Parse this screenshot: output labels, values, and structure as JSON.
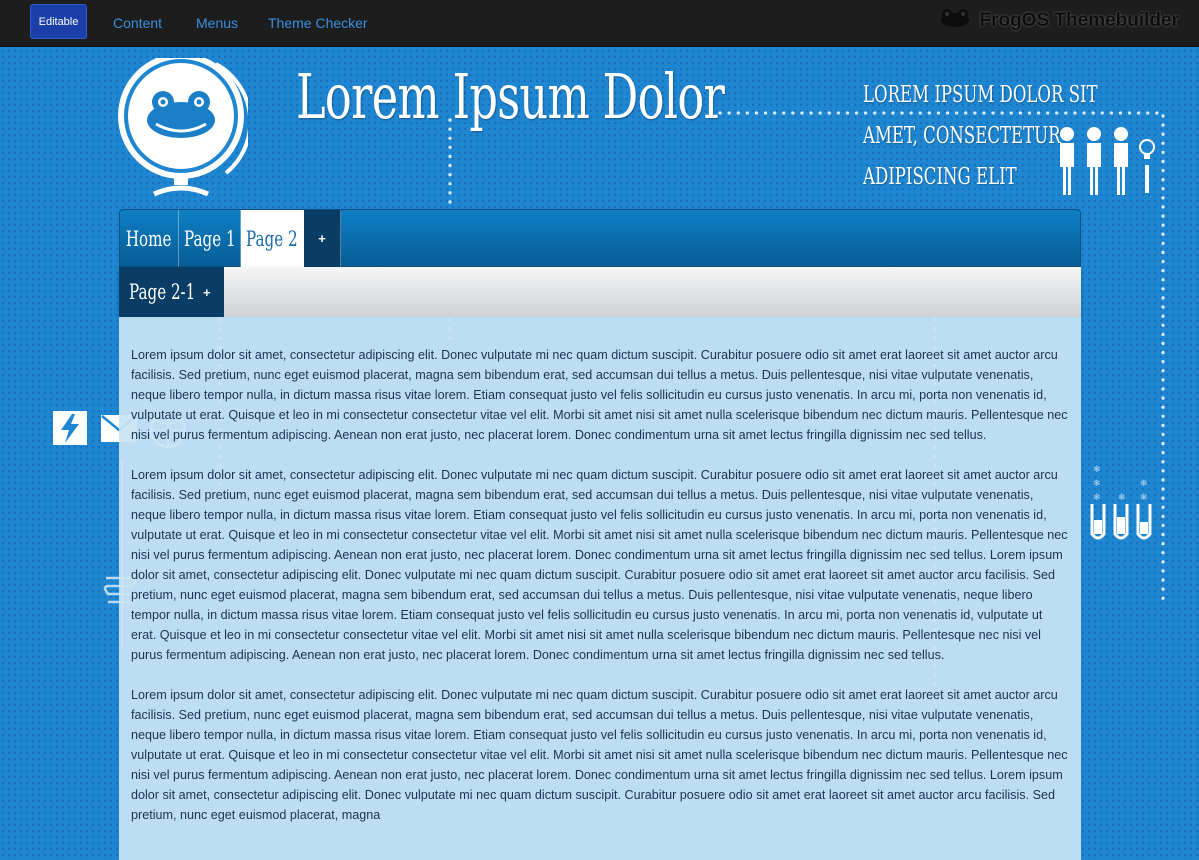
{
  "topbar": {
    "editable_label": "Editable",
    "links": [
      "Content",
      "Menus",
      "Theme Checker"
    ],
    "brand": "FrogOS Themebuilder"
  },
  "header": {
    "title": "Lorem Ipsum Dolor",
    "tagline": [
      "Lorem ipsum dolor sit",
      "amet, consectetur",
      "adipiscing elit"
    ]
  },
  "nav": {
    "items": [
      {
        "label": "Home"
      },
      {
        "label": "Page 1"
      },
      {
        "label": "Page 2",
        "active": true
      },
      {
        "label": "+"
      }
    ],
    "sub_items": [
      {
        "label": "Page 2-1",
        "add": "+"
      }
    ]
  },
  "content": {
    "paragraphs": [
      "Lorem ipsum dolor sit amet, consectetur adipiscing elit. Donec vulputate mi nec quam dictum suscipit. Curabitur posuere odio sit amet erat laoreet sit amet auctor arcu facilisis. Sed pretium, nunc eget euismod placerat, magna sem bibendum erat, sed accumsan dui tellus a metus. Duis pellentesque, nisi vitae vulputate venenatis, neque libero tempor nulla, in dictum massa risus vitae lorem. Etiam consequat justo vel felis sollicitudin eu cursus justo venenatis. In arcu mi, porta non venenatis id, vulputate ut erat. Quisque et leo in mi consectetur consectetur vitae vel elit. Morbi sit amet nisi sit amet nulla scelerisque bibendum nec dictum mauris. Pellentesque nec nisi vel purus fermentum adipiscing. Aenean non erat justo, nec placerat lorem. Donec condimentum urna sit amet lectus fringilla dignissim nec sed tellus.",
      "Lorem ipsum dolor sit amet, consectetur adipiscing elit. Donec vulputate mi nec quam dictum suscipit. Curabitur posuere odio sit amet erat laoreet sit amet auctor arcu facilisis. Sed pretium, nunc eget euismod placerat, magna sem bibendum erat, sed accumsan dui tellus a metus. Duis pellentesque, nisi vitae vulputate venenatis, neque libero tempor nulla, in dictum massa risus vitae lorem. Etiam consequat justo vel felis sollicitudin eu cursus justo venenatis. In arcu mi, porta non venenatis id, vulputate ut erat. Quisque et leo in mi consectetur consectetur vitae vel elit. Morbi sit amet nisi sit amet nulla scelerisque bibendum nec dictum mauris. Pellentesque nec nisi vel purus fermentum adipiscing. Aenean non erat justo, nec placerat lorem. Donec condimentum urna sit amet lectus fringilla dignissim nec sed tellus. Lorem ipsum dolor sit amet, consectetur adipiscing elit. Donec vulputate mi nec quam dictum suscipit. Curabitur posuere odio sit amet erat laoreet sit amet auctor arcu facilisis. Sed pretium, nunc eget euismod placerat, magna sem bibendum erat, sed accumsan dui tellus a metus. Duis pellentesque, nisi vitae vulputate venenatis, neque libero tempor nulla, in dictum massa risus vitae lorem. Etiam consequat justo vel felis sollicitudin eu cursus justo venenatis. In arcu mi, porta non venenatis id, vulputate ut erat. Quisque et leo in mi consectetur consectetur vitae vel elit. Morbi sit amet nisi sit amet nulla scelerisque bibendum nec dictum mauris. Pellentesque nec nisi vel purus fermentum adipiscing. Aenean non erat justo, nec placerat lorem. Donec condimentum urna sit amet lectus fringilla dignissim nec sed tellus.",
      "Lorem ipsum dolor sit amet, consectetur adipiscing elit. Donec vulputate mi nec quam dictum suscipit. Curabitur posuere odio sit amet erat laoreet sit amet auctor arcu facilisis. Sed pretium, nunc eget euismod placerat, magna sem bibendum erat, sed accumsan dui tellus a metus. Duis pellentesque, nisi vitae vulputate venenatis, neque libero tempor nulla, in dictum massa risus vitae lorem. Etiam consequat justo vel felis sollicitudin eu cursus justo venenatis. In arcu mi, porta non venenatis id, vulputate ut erat. Quisque et leo in mi consectetur consectetur vitae vel elit. Morbi sit amet nisi sit amet nulla scelerisque bibendum nec dictum mauris. Pellentesque nec nisi vel purus fermentum adipiscing. Aenean non erat justo, nec placerat lorem. Donec condimentum urna sit amet lectus fringilla dignissim nec sed tellus. Lorem ipsum dolor sit amet, consectetur adipiscing elit. Donec vulputate mi nec quam dictum suscipit. Curabitur posuere odio sit amet erat laoreet sit amet auctor arcu facilisis. Sed pretium, nunc eget euismod placerat, magna"
    ]
  },
  "icons": {
    "side_left": [
      "lightning-icon",
      "mail-icon",
      "globe-icon"
    ],
    "side_right": [
      "test-tubes-icon"
    ],
    "header_right": [
      "people-icon",
      "lightbulb-icon"
    ]
  },
  "colors": {
    "background": "#1f86d2",
    "topbar": "#1d1d1d",
    "nav": "#0e7fc4",
    "nav_dark": "#0a3d66",
    "content_panel": "#c8e4f5",
    "link": "#3b8fe0"
  }
}
